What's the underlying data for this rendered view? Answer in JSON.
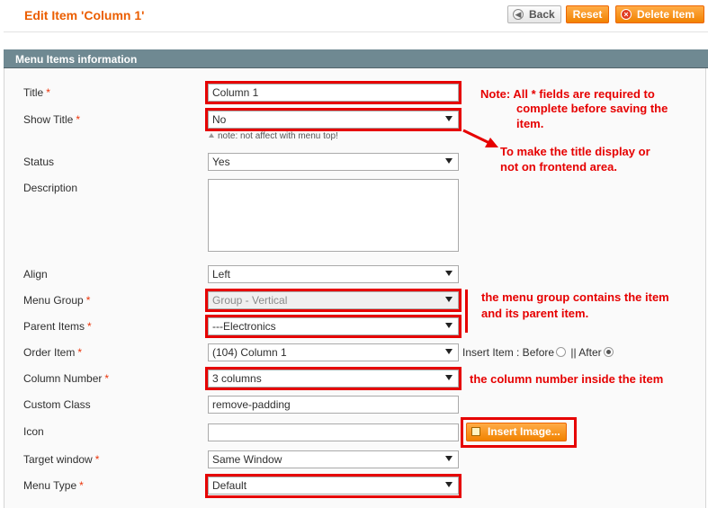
{
  "header": {
    "title": "Edit Item 'Column 1'",
    "back_label": "Back",
    "reset_label": "Reset",
    "delete_label": "Delete Item"
  },
  "section": {
    "title": "Menu Items information"
  },
  "fields": {
    "title": {
      "label": "Title",
      "value": "Column 1"
    },
    "show_title": {
      "label": "Show Title",
      "value": "No",
      "note": "note: not affect with menu top!"
    },
    "status": {
      "label": "Status",
      "value": "Yes"
    },
    "description": {
      "label": "Description",
      "value": ""
    },
    "align": {
      "label": "Align",
      "value": "Left"
    },
    "menu_group": {
      "label": "Menu Group",
      "value": "Group - Vertical"
    },
    "parent_items": {
      "label": "Parent Items",
      "value": "---Electronics"
    },
    "order_item": {
      "label": "Order Item",
      "value": "(104) Column 1",
      "insert_prefix": "Insert Item : Before",
      "insert_sep": "|| After"
    },
    "column_number": {
      "label": "Column Number",
      "value": "3 columns"
    },
    "custom_class": {
      "label": "Custom Class",
      "value": "remove-padding"
    },
    "icon": {
      "label": "Icon",
      "value": "",
      "button_label": "Insert Image..."
    },
    "target_window": {
      "label": "Target window",
      "value": "Same Window"
    },
    "menu_type": {
      "label": "Menu Type",
      "value": "Default"
    }
  },
  "required_marker": "*",
  "annotations": {
    "note_line1": "Note: All * fields are required to",
    "note_line2": "complete before saving the",
    "note_line3": "item.",
    "title_display_line1": "To make the title display or",
    "title_display_line2": "not on frontend area.",
    "menu_group_line1": "the menu group contains the item",
    "menu_group_line2": "and its parent item.",
    "column_number": "the column number inside the item"
  },
  "colors": {
    "accent": "#eb5e00",
    "section_header": "#6f8992",
    "annotation": "#e60000",
    "button_orange": "#f18200"
  },
  "icons": {
    "back": "back-arrow-icon",
    "delete": "delete-circle-icon",
    "insert_image": "image-icon"
  }
}
